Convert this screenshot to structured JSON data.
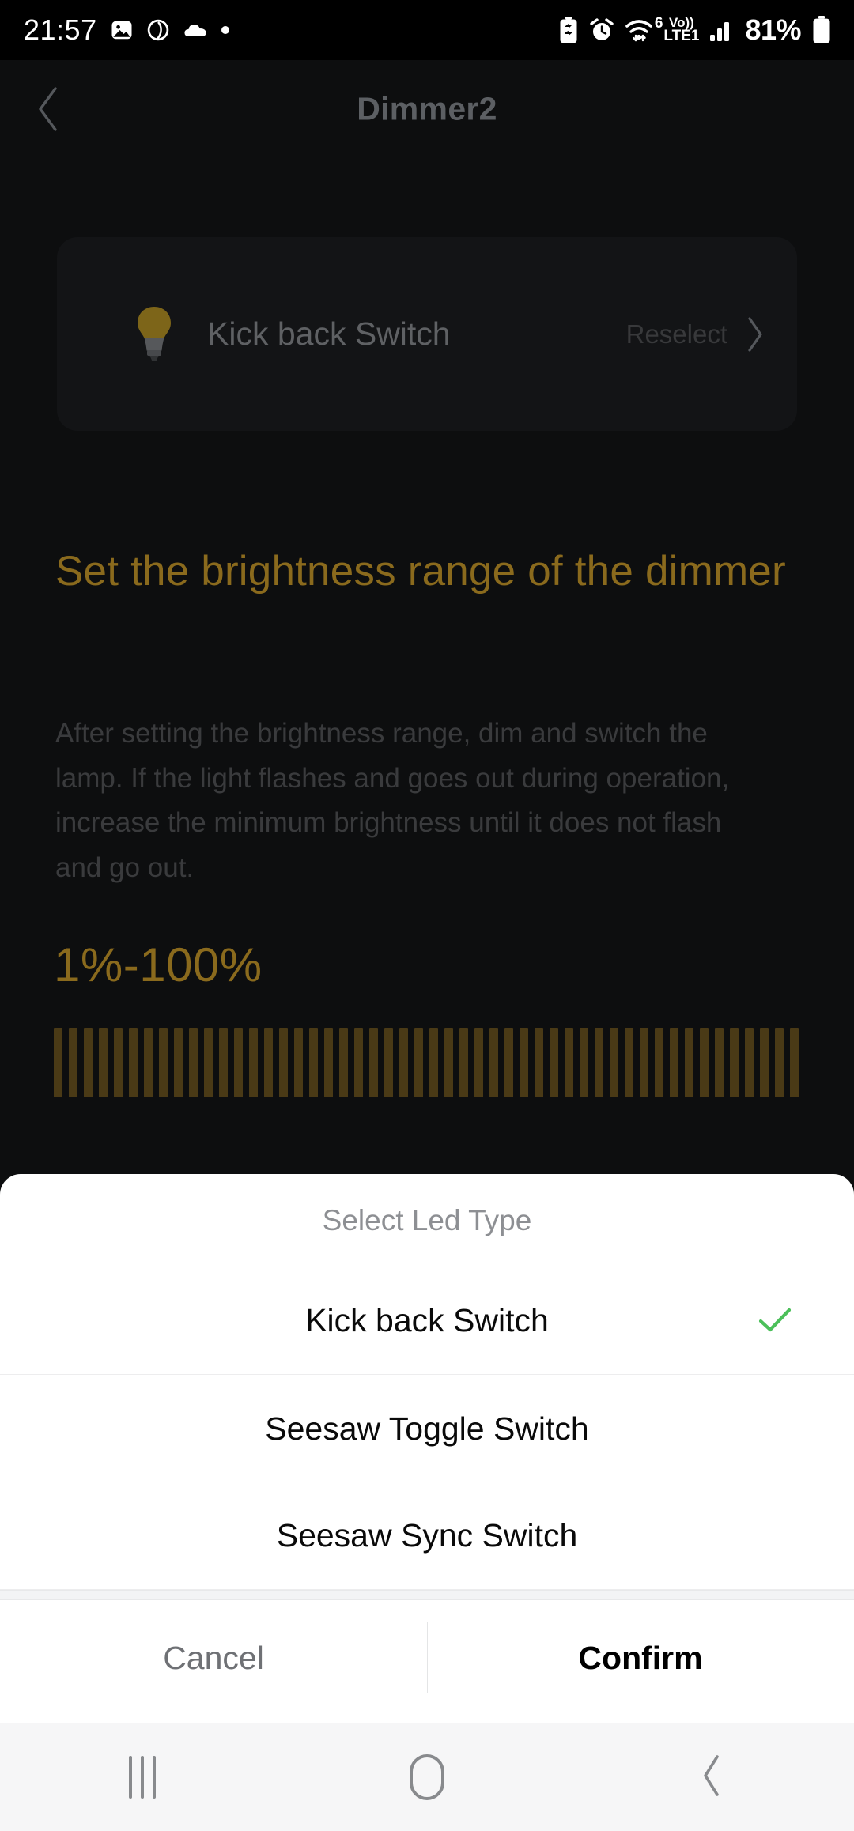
{
  "status_bar": {
    "time": "21:57",
    "battery_percent": "81%",
    "volte_top": "Vo))",
    "volte_bottom": "LTE1",
    "wifi_generation": "6",
    "left_icons": [
      "image-icon",
      "assistant-circle-icon",
      "cloud-icon",
      "dot-icon"
    ],
    "right_icons": [
      "battery-saver-icon",
      "alarm-icon",
      "wifi-icon",
      "volte-icon",
      "signal-bars-icon",
      "battery-icon"
    ]
  },
  "app_bar": {
    "title": "Dimmer2",
    "back_icon": "chevron-left-icon"
  },
  "device_card": {
    "icon": "light-bulb-icon",
    "device_name": "Kick back Switch",
    "reselect_label": "Reselect",
    "reselect_icon": "chevron-right-icon"
  },
  "content": {
    "heading": "Set the brightness range of the dimmer",
    "body": "After setting the brightness range, dim and switch the lamp. If the light flashes and goes out during operation, increase the minimum brightness until it does not flash and go out.",
    "range_value": "1%-100%",
    "slider_tick_count": 50,
    "min_percent": 1,
    "max_percent": 100
  },
  "bottom_sheet": {
    "title": "Select Led Type",
    "options": [
      {
        "label": "Kick back Switch",
        "selected": true,
        "check_icon": "check-icon"
      },
      {
        "label": "Seesaw Toggle Switch",
        "selected": false
      },
      {
        "label": "Seesaw Sync Switch",
        "selected": false
      }
    ],
    "cancel_label": "Cancel",
    "confirm_label": "Confirm"
  },
  "nav_bar": {
    "recents_icon": "recents-icon",
    "home_icon": "home-icon",
    "back_icon": "back-chevron-icon"
  },
  "colors": {
    "page_background": "#0d0e0f",
    "card_background": "#131416",
    "accent_gold": "#8a6a1d",
    "slider_tick": "#4a3a16",
    "check_green": "#4cc05a",
    "sheet_background": "#ffffff"
  }
}
